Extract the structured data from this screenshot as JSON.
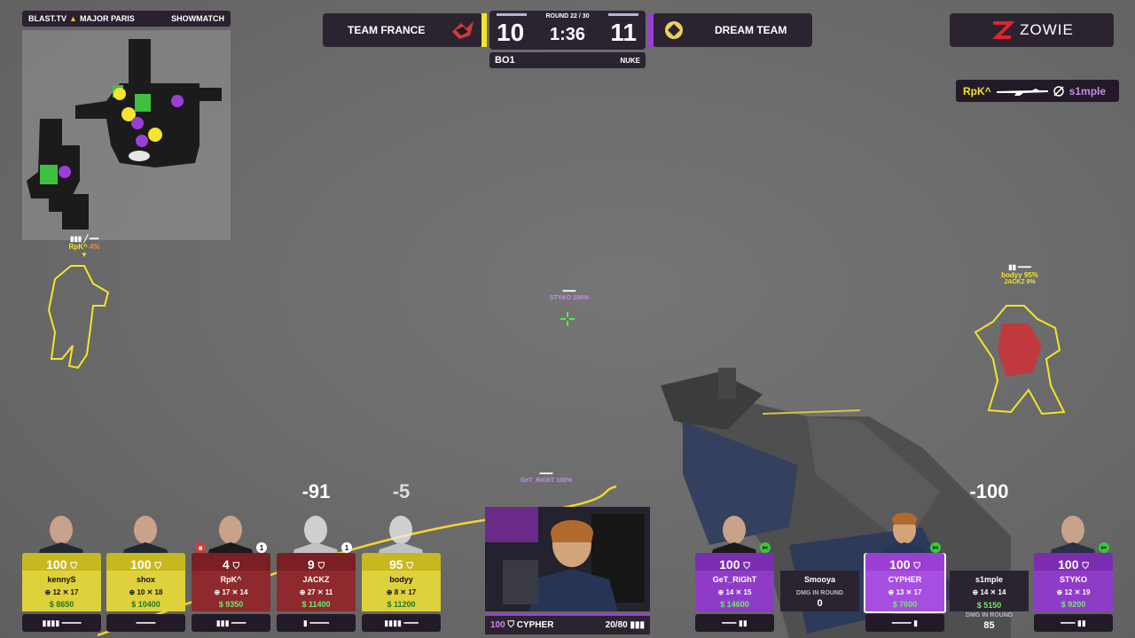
{
  "event": {
    "name": "BLAST.TV",
    "sub": "MAJOR PARIS",
    "tag": "SHOWMATCH"
  },
  "match": {
    "team_left": "TEAM FRANCE",
    "team_right": "DREAM TEAM",
    "round": "ROUND 22 / 30",
    "score_left": "10",
    "score_right": "11",
    "clock": "1:36",
    "format": "BO1",
    "map": "NUKE",
    "accent_left": "#f4e42b",
    "accent_right": "#9b3ed6"
  },
  "sponsor": {
    "name": "ZOWIE"
  },
  "killfeed": {
    "killer": "RpK^",
    "victim": "s1mple",
    "weapon_icon": "awp-icon",
    "modifier_icon": "noscope-icon"
  },
  "world": {
    "minimap_player": {
      "name": "RpK^",
      "hp": "4%"
    },
    "enemy_name": "bodyy 95%",
    "enemy_name2": "JACKZ 9%",
    "ally_mid": "STYKO 100%",
    "ally_low": "GeT_RiGhT 100%"
  },
  "left_team": [
    {
      "name": "kennyS",
      "hp": "100",
      "k": "12",
      "d": "17",
      "money": "$ 8650",
      "dmg": ""
    },
    {
      "name": "shox",
      "hp": "100",
      "k": "10",
      "d": "18",
      "money": "$ 10400",
      "dmg": ""
    },
    {
      "name": "RpK^",
      "hp": "4",
      "k": "17",
      "d": "14",
      "money": "$ 9350",
      "dmg": "",
      "badge": "1"
    },
    {
      "name": "JACKZ",
      "hp": "9",
      "k": "27",
      "d": "11",
      "money": "$ 11400",
      "dmg": "-91",
      "badge": "1"
    },
    {
      "name": "bodyy",
      "hp": "95",
      "k": "8",
      "d": "17",
      "money": "$ 11200",
      "dmg": "-5"
    }
  ],
  "right_team": [
    {
      "name": "GeT_RiGhT",
      "hp": "100",
      "k": "14",
      "d": "15",
      "money": "$ 14600"
    },
    {
      "name": "Smooya",
      "dead": true,
      "dmg_label": "DMG IN ROUND",
      "dmg_value": "0"
    },
    {
      "name": "CYPHER",
      "hp": "100",
      "k": "13",
      "d": "17",
      "money": "$ 7600"
    },
    {
      "name": "s1mple",
      "dead": true,
      "k": "14",
      "d": "14",
      "money": "$ 5150",
      "dmg": "-100",
      "dmg_label": "DMG IN ROUND",
      "dmg_value": "85"
    },
    {
      "name": "STYKO",
      "hp": "100",
      "k": "12",
      "d": "19",
      "money": "$ 9200"
    }
  ],
  "observer": {
    "hp": "100",
    "name": "CYPHER",
    "ammo": "20/80"
  }
}
